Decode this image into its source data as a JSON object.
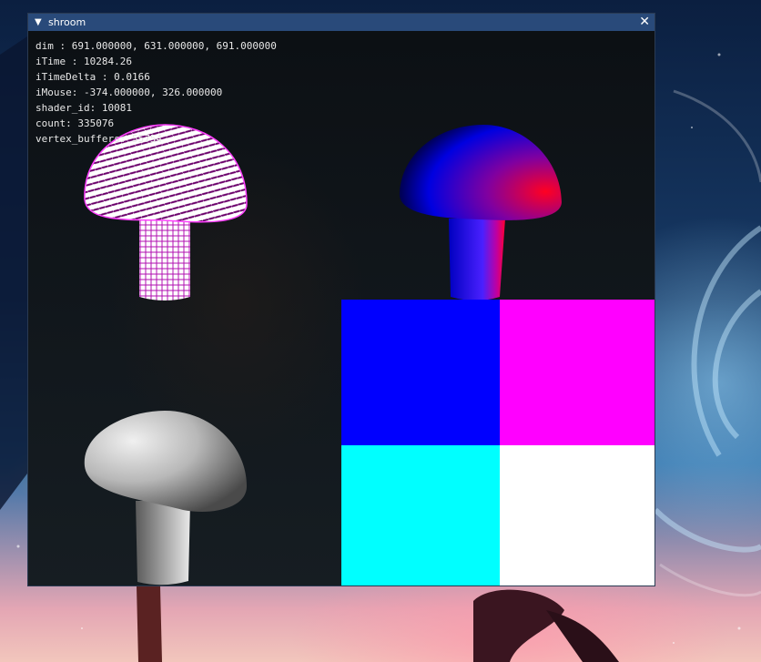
{
  "window": {
    "title": "shroom"
  },
  "stats": {
    "dim": "dim : 691.000000, 631.000000, 691.000000",
    "itime": "iTime : 10284.26",
    "itime_delta": "iTimeDelta : 0.0166",
    "imouse": "iMouse: -374.000000, 326.000000",
    "shader_id": "shader_id: 10081",
    "count": "count: 335076",
    "vertex_buffers": "vertex_buffers: 55754"
  },
  "quad_colors": {
    "top_left": "#0000ff",
    "top_right": "#ff00ff",
    "bottom_left": "#00ffff",
    "bottom_right": "#ffffff"
  },
  "colors": {
    "titlebar": "#294a7a",
    "viewport_bg": "#0d1115",
    "wireframe": "#ff33ff"
  }
}
